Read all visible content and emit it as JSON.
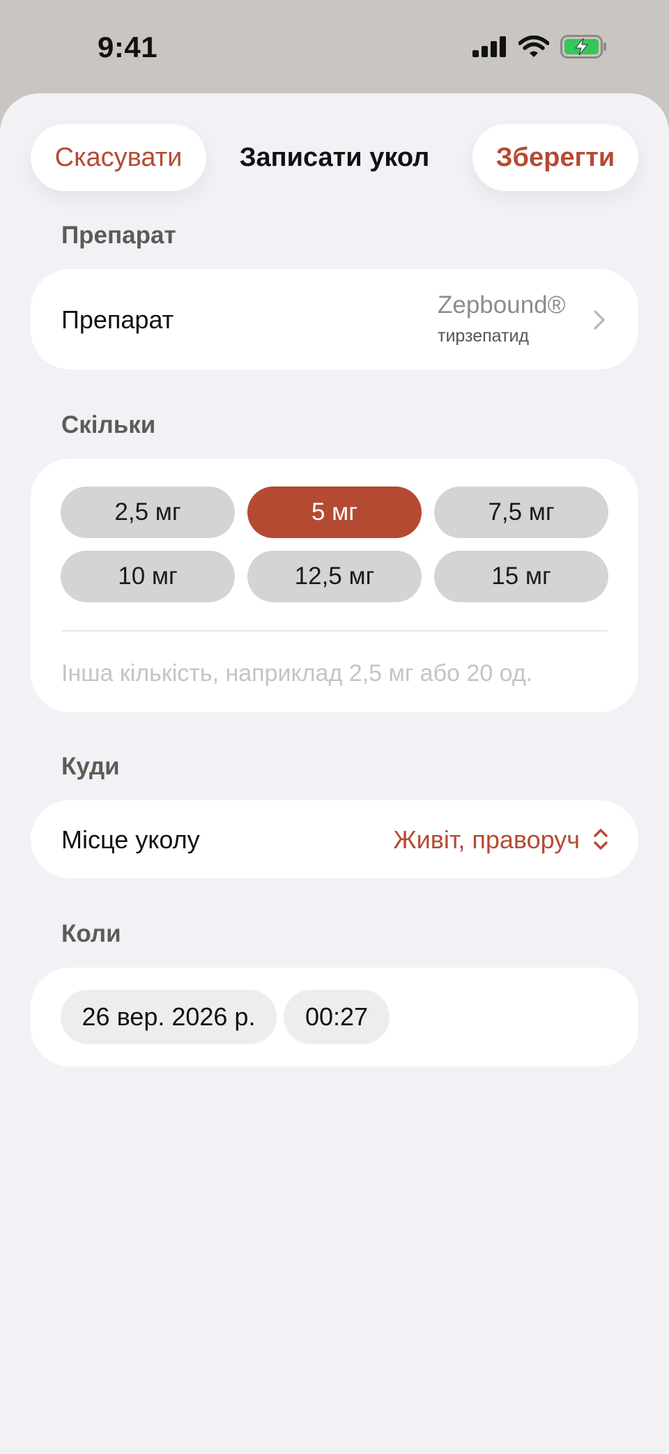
{
  "status_bar": {
    "time": "9:41",
    "battery_color": "#34c759"
  },
  "nav": {
    "cancel_label": "Скасувати",
    "title": "Записати укол",
    "save_label": "Зберегти",
    "accent_color": "#b54a33"
  },
  "medication": {
    "section_label": "Препарат",
    "row_label": "Препарат",
    "name": "Zepbound®",
    "generic_name": "тирзепатид"
  },
  "dose": {
    "section_label": "Скільки",
    "options": [
      {
        "label": "2,5 мг",
        "selected": false
      },
      {
        "label": "5 мг",
        "selected": true
      },
      {
        "label": "7,5 мг",
        "selected": false
      },
      {
        "label": "10 мг",
        "selected": false
      },
      {
        "label": "12,5 мг",
        "selected": false
      },
      {
        "label": "15 мг",
        "selected": false
      }
    ],
    "custom_placeholder": "Інша кількість, наприклад 2,5 мг або 20 од.",
    "custom_value": ""
  },
  "site": {
    "section_label": "Куди",
    "row_label": "Місце уколу",
    "value": "Живіт, праворуч"
  },
  "when": {
    "section_label": "Коли",
    "date": "26 вер. 2026 р.",
    "time": "00:27"
  }
}
